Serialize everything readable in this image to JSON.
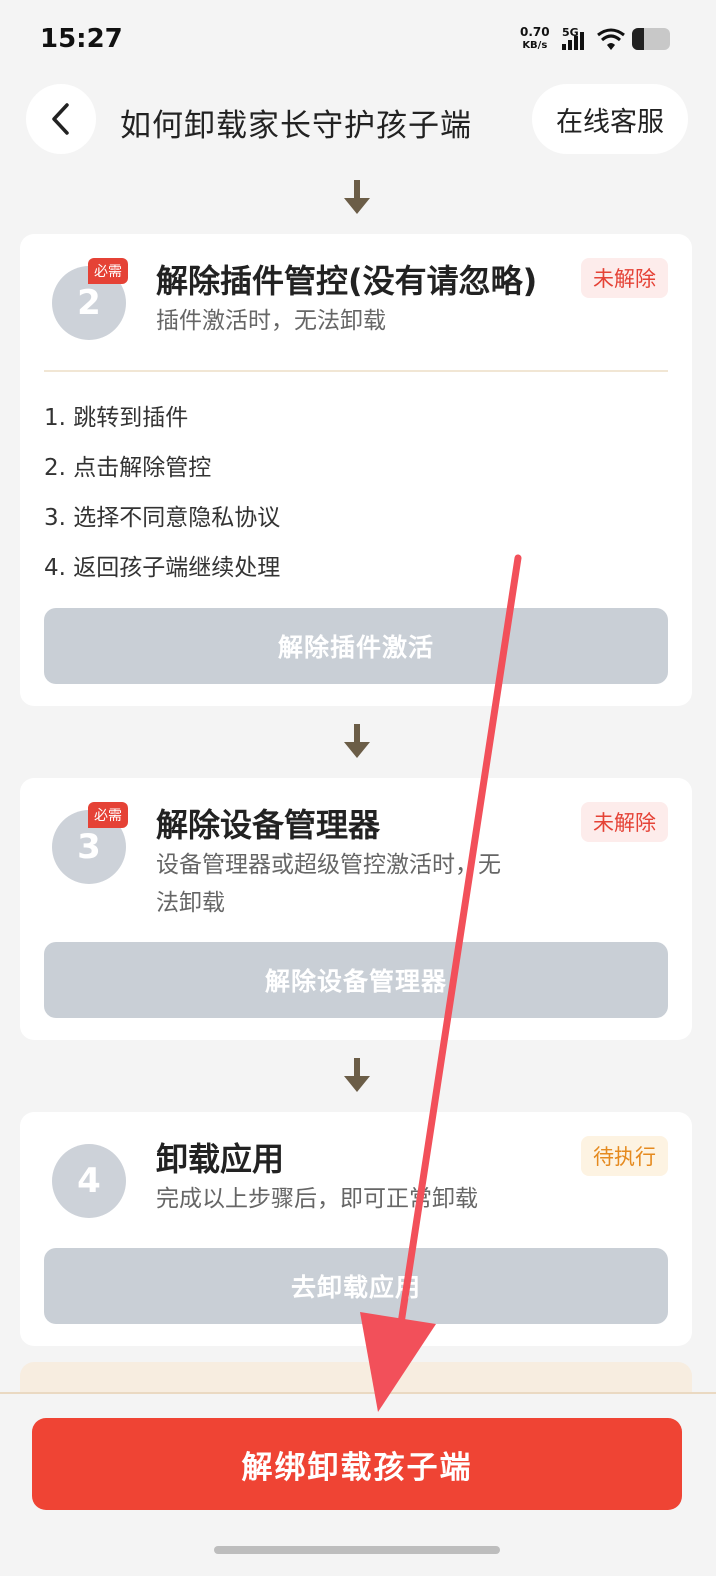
{
  "status_bar": {
    "time": "15:27",
    "net_speed_value": "0.70",
    "net_speed_unit": "KB/s",
    "network_type": "5G",
    "icons": [
      "signal-icon",
      "wifi-icon",
      "battery-icon"
    ]
  },
  "header": {
    "back_icon": "chevron-left-icon",
    "title": "如何卸载家长守护孩子端",
    "service_button": "在线客服"
  },
  "steps": [
    {
      "number": "2",
      "required_badge": "必需",
      "title": "解除插件管控(没有请忽略)",
      "description": "插件激活时，无法卸载",
      "status": "未解除",
      "instructions": [
        "1. 跳转到插件",
        "2. 点击解除管控",
        "3. 选择不同意隐私协议",
        "4. 返回孩子端继续处理"
      ],
      "button": "解除插件激活"
    },
    {
      "number": "3",
      "required_badge": "必需",
      "title": "解除设备管理器",
      "description_line1": "设备管理器或超级管控激活时，无",
      "description_line2": "法卸载",
      "status": "未解除",
      "button": "解除设备管理器"
    },
    {
      "number": "4",
      "title": "卸载应用",
      "description": "完成以上步骤后，即可正常卸载",
      "status": "待执行",
      "button": "去卸载应用"
    }
  ],
  "bottom": {
    "primary_button": "解绑卸载孩子端"
  },
  "colors": {
    "accent_red": "#ef4434",
    "badge_red": "#e54236",
    "badge_orange": "#e58a1f",
    "disabled_button": "#c9cfd6",
    "annotation_arrow": "#f2505a"
  }
}
